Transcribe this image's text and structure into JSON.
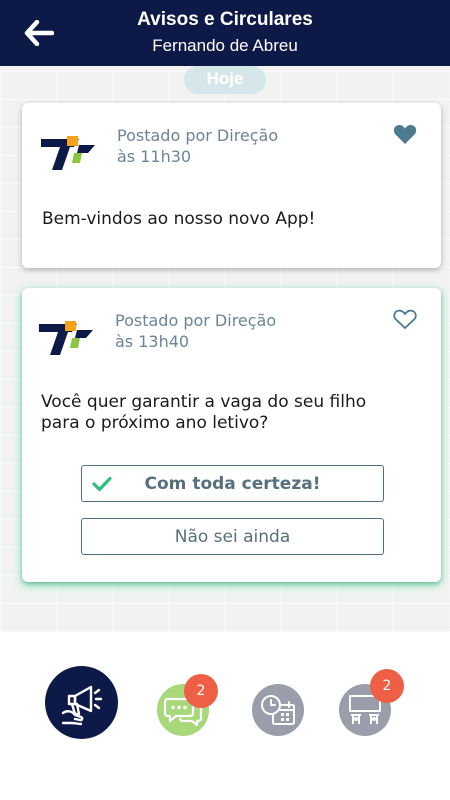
{
  "header": {
    "title": "Avisos e Circulares",
    "subtitle": "Fernando de Abreu"
  },
  "feed": {
    "day_label": "Hoje",
    "posts": [
      {
        "posted_by": "Postado por Direção",
        "time": "às 11h30",
        "message": "Bem-vindos ao nosso novo App!",
        "liked": true
      },
      {
        "posted_by": "Postado por Direção",
        "time": "às 13h40",
        "message_line1": "Você quer garantir a vaga do seu filho",
        "message_line2": "para o próximo ano letivo?",
        "liked": false,
        "answers": [
          {
            "label": "Com toda certeza!",
            "selected": true
          },
          {
            "label": "Não sei ainda",
            "selected": false
          }
        ]
      }
    ]
  },
  "nav": {
    "items": [
      {
        "name": "announcements",
        "icon": "megaphone-icon",
        "active": true,
        "badge": ""
      },
      {
        "name": "messages",
        "icon": "chat-bubbles-icon",
        "active": false,
        "badge": "2"
      },
      {
        "name": "schedule",
        "icon": "calendar-clock-icon",
        "active": false,
        "badge": ""
      },
      {
        "name": "classroom",
        "icon": "classroom-board-icon",
        "active": false,
        "badge": "2"
      }
    ]
  },
  "colors": {
    "header_bg": "#0d1a48",
    "accent_green": "#4ce6a2",
    "heart_blue": "#4c7a8f",
    "badge_red": "#ee5f45",
    "logo_orange": "#f6a21c",
    "logo_green": "#8cc63f"
  }
}
